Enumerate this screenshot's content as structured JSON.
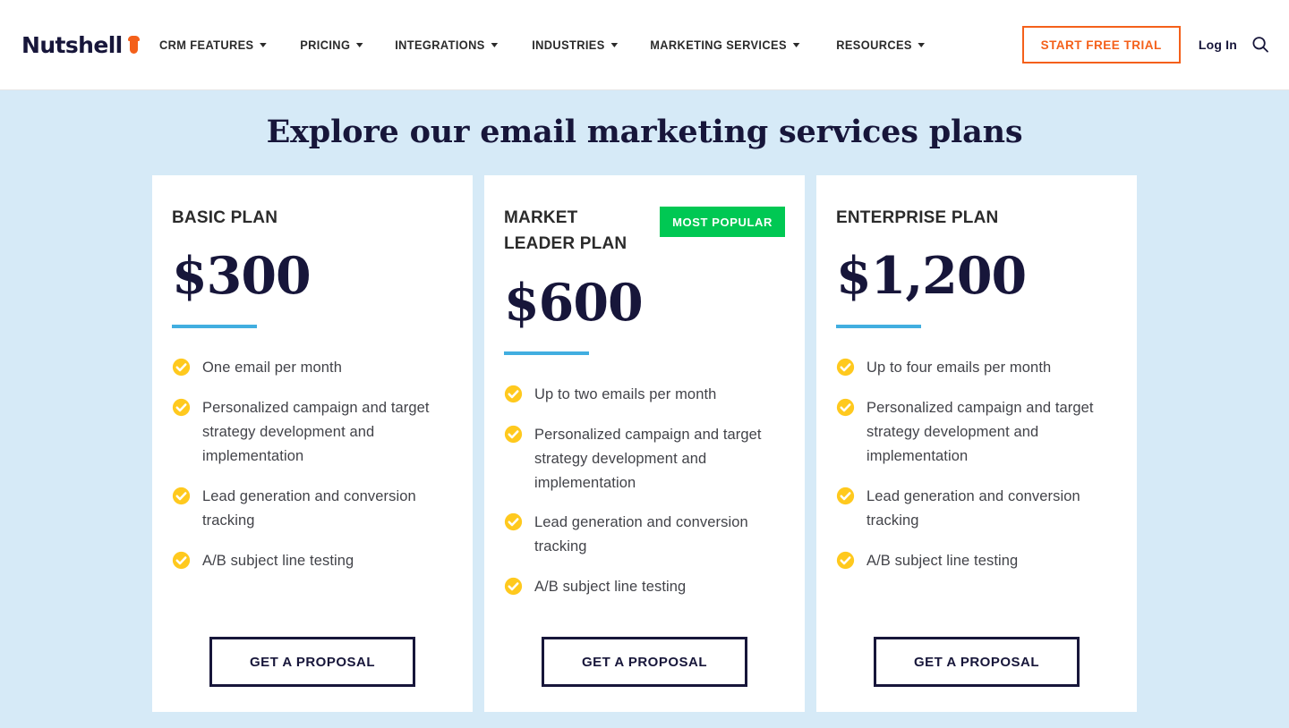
{
  "header": {
    "logo_text": "Nutshell",
    "logo_icon": "acorn-icon",
    "nav_items": [
      {
        "label": "CRM FEATURES",
        "has_dropdown": true
      },
      {
        "label": "PRICING",
        "has_dropdown": true
      },
      {
        "label": "INTEGRATIONS",
        "has_dropdown": true
      },
      {
        "label": "INDUSTRIES",
        "has_dropdown": true
      },
      {
        "label": "MARKETING SERVICES",
        "has_dropdown": true
      },
      {
        "label": "RESOURCES",
        "has_dropdown": true
      }
    ],
    "trial_button": "START FREE TRIAL",
    "login_link": "Log In",
    "search_icon": "search-icon"
  },
  "main": {
    "section_title": "Explore our email marketing services plans",
    "plans": [
      {
        "name": "BASIC PLAN",
        "price": "$300",
        "badge": null,
        "features": [
          "One email per month",
          "Personalized campaign and target strategy development and implementation",
          "Lead generation and conversion tracking",
          "A/B subject line testing"
        ],
        "cta": "GET A PROPOSAL"
      },
      {
        "name": "MARKET LEADER PLAN",
        "price": "$600",
        "badge": "MOST POPULAR",
        "features": [
          "Up to two emails per month",
          "Personalized campaign and target strategy development and implementation",
          "Lead generation and conversion tracking",
          "A/B subject line testing"
        ],
        "cta": "GET A PROPOSAL"
      },
      {
        "name": "ENTERPRISE PLAN",
        "price": "$1,200",
        "badge": null,
        "features": [
          "Up to four emails per month",
          "Personalized campaign and target strategy development and implementation",
          "Lead generation and conversion tracking",
          "A/B subject line testing"
        ],
        "cta": "GET A PROPOSAL"
      }
    ]
  },
  "colors": {
    "page_background": "#d6eaf7",
    "brand_navy": "#17163a",
    "brand_orange": "#f4601a",
    "badge_green": "#00c853",
    "rule_blue": "#41aee0",
    "check_yellow": "#ffc91e",
    "card_background": "#ffffff"
  }
}
